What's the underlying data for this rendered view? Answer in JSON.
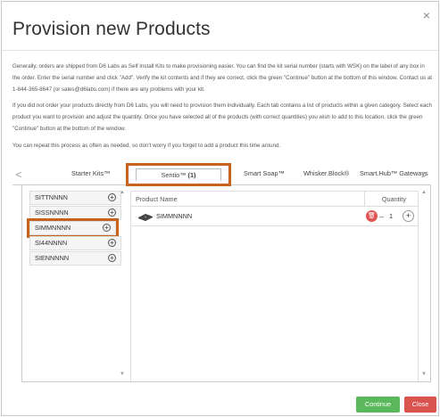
{
  "dialog": {
    "title": "Provision new Products",
    "close_glyph": "×"
  },
  "instructions": {
    "p1": "Generally, orders are shipped from D6 Labs as Self Install Kits to make provisioning easier. You can find the kit serial number (starts with WSK) on the label of any box in the order. Enter the serial number and click \"Add\". Verify the kit contents and if they are correct, click the green \"Continue\" button at the bottom of this window. Contact us at 1-844-365-8647 (or sales@d6labs.com) if there are any problems with your kit.",
    "p2": "If you did not order your products directly from D6 Labs, you will need to provision them individually. Each tab contains a list of products within a given category. Select each product you want to provision and adjust the quantity. Once you have selected all of the products (with correct quantities) you wish to add to this location, click the green \"Continue\" button at the bottom of the window.",
    "p3": "You can repeat this process as often as needed, so don't worry if you forget to add a product this time around."
  },
  "tabs": {
    "left_arrow": "<",
    "right_arrow": ">",
    "items": [
      {
        "label": "Starter Kits™"
      },
      {
        "label": "Sentio™",
        "count": "(1)"
      },
      {
        "label": "Smart Soap™"
      },
      {
        "label": "Whisker.Block®"
      },
      {
        "label": "Smart.Hub™ Gateways"
      }
    ]
  },
  "categories": [
    {
      "label": "SITTNNNN"
    },
    {
      "label": "SISSNNNN"
    },
    {
      "label": "SIMMNNNN"
    },
    {
      "label": "SI44NNNN"
    },
    {
      "label": "SIENNNNN"
    }
  ],
  "table": {
    "col_name": "Product Name",
    "col_qty": "Quantity",
    "rows": [
      {
        "name": "SIMMNNNN",
        "qty": "1",
        "minus": "–",
        "plus": "+"
      }
    ]
  },
  "scroll": {
    "up": "▲",
    "down": "▼"
  },
  "footer": {
    "continue_label": "Continue",
    "close_label": "Close"
  },
  "colors": {
    "highlight": "#c6641f",
    "continue": "#5cb85c",
    "close": "#d9534f",
    "delete": "#e25555"
  }
}
